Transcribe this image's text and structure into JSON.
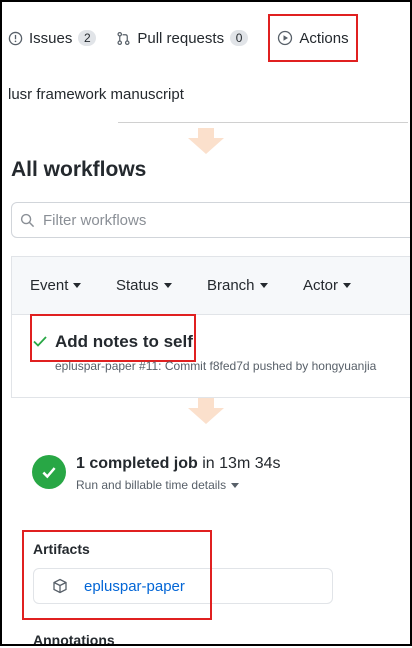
{
  "tabs": {
    "issues": {
      "label": "Issues",
      "count": "2"
    },
    "pull_requests": {
      "label": "Pull requests",
      "count": "0"
    },
    "actions": {
      "label": "Actions"
    }
  },
  "repo": {
    "description": "lusr framework manuscript"
  },
  "workflows": {
    "title": "All workflows",
    "filter_placeholder": "Filter workflows",
    "filters": [
      "Event",
      "Status",
      "Branch",
      "Actor"
    ],
    "run": {
      "title": "Add notes to self",
      "meta": "epluspar-paper #11: Commit f8fed7d pushed by hongyuanjia"
    }
  },
  "job": {
    "count_text": "1 completed job",
    "duration_text": "in 13m 34s",
    "details_link": "Run and billable time details"
  },
  "artifacts": {
    "label": "Artifacts",
    "items": [
      {
        "name": "epluspar-paper"
      }
    ]
  },
  "annotations": {
    "label": "Annotations"
  },
  "colors": {
    "highlight": "#e02020",
    "success": "#28a745",
    "link": "#0366d6",
    "arrow": "#fbe0cc"
  }
}
